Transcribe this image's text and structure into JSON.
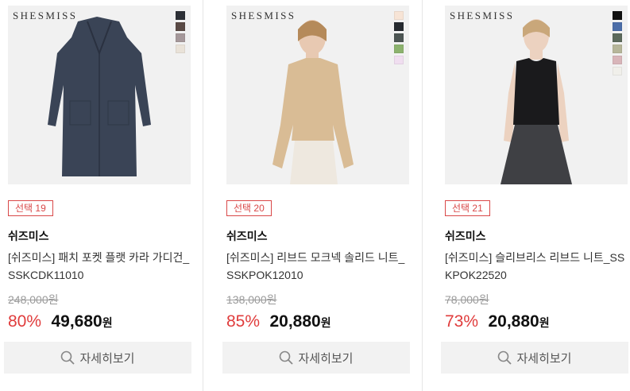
{
  "products": [
    {
      "image_brand": "SHESMISS",
      "swatches": [
        "#2c2f36",
        "#5a4a45",
        "#a5989a",
        "#e9e2d8"
      ],
      "garment_color": "#3a4456",
      "badge": "선택 19",
      "brand": "쉬즈미스",
      "title": "[쉬즈미스] 패치 포켓 플랫 카라 가디건_SSKCDK11010",
      "original_price": "248,000원",
      "discount": "80%",
      "price": "49,680",
      "currency": "원",
      "button_label": "자세히보기",
      "button_icon": "search-icon"
    },
    {
      "image_brand": "SHESMISS",
      "swatches": [
        "#f7e4d6",
        "#262a30",
        "#4d5654",
        "#8cb26e",
        "#f0def0"
      ],
      "garment_color": "#d9bc95",
      "badge": "선택 20",
      "brand": "쉬즈미스",
      "title": "[쉬즈미스] 리브드 모크넥 솔리드 니트_SSKPOK12010",
      "original_price": "138,000원",
      "discount": "85%",
      "price": "20,880",
      "currency": "원",
      "button_label": "자세히보기",
      "button_icon": "search-icon"
    },
    {
      "image_brand": "SHESMISS",
      "swatches": [
        "#111111",
        "#4c6ea8",
        "#5c6a5c",
        "#b6b69a",
        "#d8b5b9",
        "#f0efea"
      ],
      "garment_color": "#1a1a1c",
      "badge": "선택 21",
      "brand": "쉬즈미스",
      "title": "[쉬즈미스] 슬리브리스 리브드 니트_SSKPOK22520",
      "original_price": "78,000원",
      "discount": "73%",
      "price": "20,880",
      "currency": "원",
      "button_label": "자세히보기",
      "button_icon": "search-icon"
    }
  ]
}
